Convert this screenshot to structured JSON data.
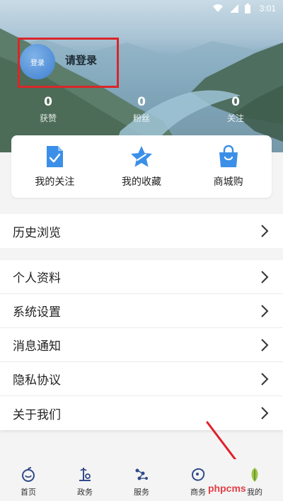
{
  "status_bar": {
    "time": "3:01"
  },
  "profile": {
    "avatar_text": "登录",
    "login_prompt": "请登录",
    "stats": [
      {
        "value": "0",
        "label": "获赞"
      },
      {
        "value": "0",
        "label": "粉丝"
      },
      {
        "value": "0",
        "label": "关注"
      }
    ]
  },
  "quick_actions": [
    {
      "label": "我的关注",
      "icon": "document-check-icon"
    },
    {
      "label": "我的收藏",
      "icon": "star-icon"
    },
    {
      "label": "商城购",
      "icon": "shopping-bag-icon"
    }
  ],
  "menu_section_1": [
    {
      "label": "历史浏览"
    }
  ],
  "menu_section_2": [
    {
      "label": "个人资料"
    },
    {
      "label": "系统设置"
    },
    {
      "label": "消息通知"
    },
    {
      "label": "隐私协议"
    },
    {
      "label": "关于我们"
    }
  ],
  "bottom_nav": [
    {
      "label": "首页",
      "icon": "home-icon"
    },
    {
      "label": "政务",
      "icon": "government-icon"
    },
    {
      "label": "服务",
      "icon": "service-icon"
    },
    {
      "label": "商务",
      "icon": "business-icon"
    },
    {
      "label": "我的",
      "icon": "profile-leaf-icon",
      "active": true
    }
  ],
  "watermark": "phpcms",
  "colors": {
    "accent_blue": "#3b8fe8",
    "highlight_red": "#d9262a"
  }
}
